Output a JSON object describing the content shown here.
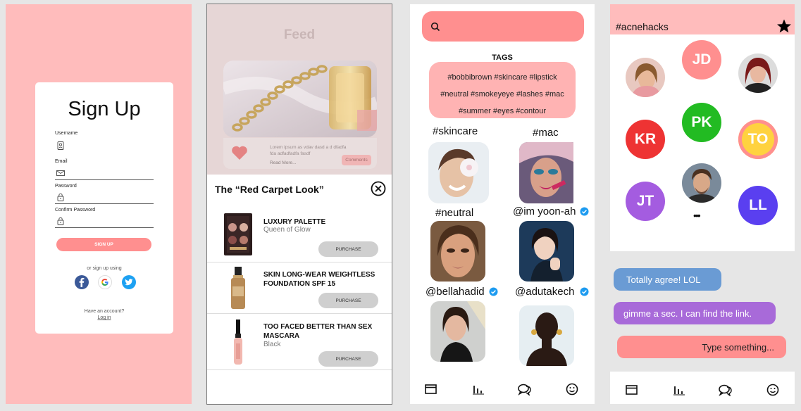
{
  "signup": {
    "title": "Sign Up",
    "username_label": "Username",
    "email_label": "Email",
    "password_label": "Password",
    "confirm_label": "Confirm Password",
    "button": "SIGN UP",
    "or_text": "or sign up using",
    "have_account": "Have an account?",
    "login": "Log in",
    "social_icons": [
      "facebook-icon",
      "google-icon",
      "twitter-icon"
    ]
  },
  "feed": {
    "title": "Feed",
    "lorem": "Lorem ipsum as vdav dasd a d dfadfa fda adfadfadfa fasdf",
    "read_more": "Read More...",
    "comments": "Comments",
    "sheet_title": "The “Red Carpet Look”",
    "products": [
      {
        "name": "LUXURY PALETTE",
        "sub": "Queen of Glow",
        "button": "PURCHASE"
      },
      {
        "name": "SKIN LONG-WEAR WEIGHTLESS FOUNDATION SPF 15",
        "sub": "",
        "button": "PURCHASE"
      },
      {
        "name": "TOO FACED BETTER THAN SEX MASCARA",
        "sub": "Black",
        "button": "PURCHASE"
      }
    ]
  },
  "tags": {
    "label": "TAGS",
    "lines": [
      "#bobbibrown #skincare #lipstick",
      "#neutral #smokeyeye #lashes #mac",
      "#summer #eyes #contour"
    ],
    "grid": [
      {
        "label": "#skincare"
      },
      {
        "label": "#mac"
      },
      {
        "label": "#neutral"
      },
      {
        "label": "@im yoon-ah"
      },
      {
        "label": "@bellahadid"
      },
      {
        "label": "@adutakech"
      }
    ],
    "nav_icons": [
      "window-icon",
      "chart-icon",
      "chat-icon",
      "smiley-icon"
    ]
  },
  "group": {
    "title": "#acnehacks",
    "avatars": [
      {
        "initials": "JD",
        "color": "#ff8f8f"
      },
      {
        "initials": "KR",
        "color": "#ee3333"
      },
      {
        "initials": "PK",
        "color": "#22bb22"
      },
      {
        "initials": "TO",
        "color": "#ffd23f",
        "ring": "#ff8f8f"
      },
      {
        "initials": "JT",
        "color": "#a45ce0"
      },
      {
        "initials": "LL",
        "color": "#5a3ff0"
      }
    ],
    "more": "•••",
    "messages": [
      {
        "text": "Totally agree! LOL",
        "color": "#6a9bd4"
      },
      {
        "text": "gimme a sec. I can find the link.",
        "color": "#a86ad9"
      }
    ],
    "input_placeholder": "Type something...",
    "input_color": "#ff8f8f"
  },
  "colors": {
    "pink_bg": "#ffbcbc",
    "accent": "#ff8f8f"
  }
}
